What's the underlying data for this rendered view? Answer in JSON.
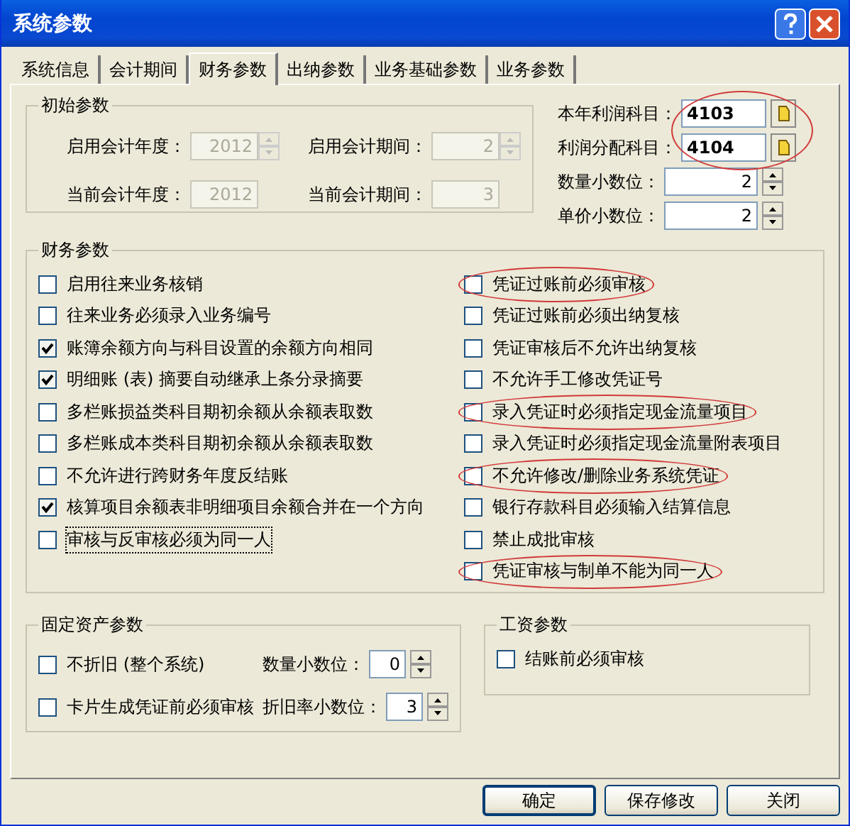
{
  "window": {
    "title": "系统参数"
  },
  "tabs": [
    {
      "label": "系统信息",
      "selected": false
    },
    {
      "label": "会计期间",
      "selected": false
    },
    {
      "label": "财务参数",
      "selected": true
    },
    {
      "label": "出纳参数",
      "selected": false
    },
    {
      "label": "业务基础参数",
      "selected": false
    },
    {
      "label": "业务参数",
      "selected": false
    }
  ],
  "initial_params": {
    "title": "初始参数",
    "fields": [
      {
        "label": "启用会计年度：",
        "value": "2012",
        "disabled": true,
        "kind": "spin"
      },
      {
        "label": "启用会计期间：",
        "value": "2",
        "disabled": true,
        "kind": "spin"
      },
      {
        "label": "当前会计年度：",
        "value": "2012",
        "disabled": true,
        "kind": "text"
      },
      {
        "label": "当前会计期间：",
        "value": "3",
        "disabled": true,
        "kind": "text"
      }
    ]
  },
  "account_fields": {
    "circled": true,
    "items": [
      {
        "label": "本年利润科目：",
        "value": "4103"
      },
      {
        "label": "利润分配科目：",
        "value": "4104"
      }
    ]
  },
  "decimal_fields": [
    {
      "label": "数量小数位：",
      "value": "2"
    },
    {
      "label": "单价小数位：",
      "value": "2"
    }
  ],
  "finance_params": {
    "title": "财务参数",
    "left": [
      {
        "label": "启用往来业务核销",
        "checked": false,
        "circled": false
      },
      {
        "label": "往来业务必须录入业务编号",
        "checked": false,
        "circled": false
      },
      {
        "label": "账簿余额方向与科目设置的余额方向相同",
        "checked": true,
        "circled": false
      },
      {
        "label": "明细账 (表) 摘要自动继承上条分录摘要",
        "checked": true,
        "circled": false
      },
      {
        "label": "多栏账损益类科目期初余额从余额表取数",
        "checked": false,
        "circled": false
      },
      {
        "label": "多栏账成本类科目期初余额从余额表取数",
        "checked": false,
        "circled": false
      },
      {
        "label": "不允许进行跨财务年度反结账",
        "checked": false,
        "circled": false
      },
      {
        "label": "核算项目余额表非明细项目余额合并在一个方向",
        "checked": true,
        "circled": false
      },
      {
        "label": "审核与反审核必须为同一人",
        "checked": false,
        "circled": false,
        "focused": true
      }
    ],
    "right": [
      {
        "label": "凭证过账前必须审核",
        "checked": false,
        "circled": true
      },
      {
        "label": "凭证过账前必须出纳复核",
        "checked": false,
        "circled": false
      },
      {
        "label": "凭证审核后不允许出纳复核",
        "checked": false,
        "circled": false
      },
      {
        "label": "不允许手工修改凭证号",
        "checked": false,
        "circled": false
      },
      {
        "label": "录入凭证时必须指定现金流量项目",
        "checked": false,
        "circled": true
      },
      {
        "label": "录入凭证时必须指定现金流量附表项目",
        "checked": false,
        "circled": false
      },
      {
        "label": "不允许修改/删除业务系统凭证",
        "checked": false,
        "circled": true
      },
      {
        "label": "银行存款科目必须输入结算信息",
        "checked": false,
        "circled": false
      },
      {
        "label": "禁止成批审核",
        "checked": false,
        "circled": false
      },
      {
        "label": "凭证审核与制单不能为同一人",
        "checked": false,
        "circled": true
      }
    ]
  },
  "fixed_assets": {
    "title": "固定资产参数",
    "checks": [
      {
        "label": "不折旧 (整个系统)",
        "checked": false
      },
      {
        "label": "卡片生成凭证前必须审核",
        "checked": false
      }
    ],
    "spins": [
      {
        "label": "数量小数位：",
        "value": "0"
      },
      {
        "label": "折旧率小数位：",
        "value": "3"
      }
    ]
  },
  "payroll": {
    "title": "工资参数",
    "checks": [
      {
        "label": "结账前必须审核",
        "checked": false
      }
    ]
  },
  "buttons": [
    {
      "label": "确定",
      "default": true
    },
    {
      "label": "保存修改",
      "default": false
    },
    {
      "label": "关闭",
      "default": false
    }
  ]
}
